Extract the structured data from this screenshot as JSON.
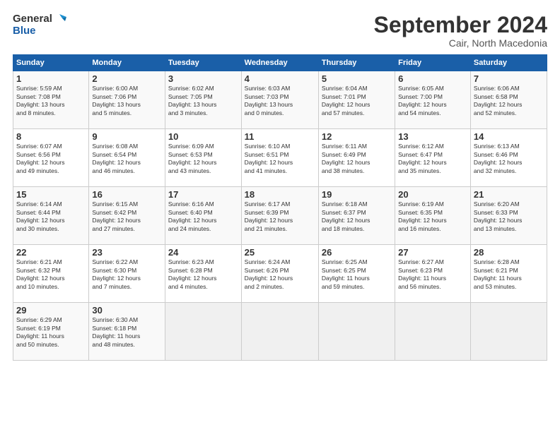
{
  "header": {
    "logo_line1": "General",
    "logo_line2": "Blue",
    "month_title": "September 2024",
    "location": "Cair, North Macedonia"
  },
  "days_of_week": [
    "Sunday",
    "Monday",
    "Tuesday",
    "Wednesday",
    "Thursday",
    "Friday",
    "Saturday"
  ],
  "weeks": [
    [
      {
        "day": "1",
        "lines": [
          "Sunrise: 5:59 AM",
          "Sunset: 7:08 PM",
          "Daylight: 13 hours",
          "and 8 minutes."
        ]
      },
      {
        "day": "2",
        "lines": [
          "Sunrise: 6:00 AM",
          "Sunset: 7:06 PM",
          "Daylight: 13 hours",
          "and 5 minutes."
        ]
      },
      {
        "day": "3",
        "lines": [
          "Sunrise: 6:02 AM",
          "Sunset: 7:05 PM",
          "Daylight: 13 hours",
          "and 3 minutes."
        ]
      },
      {
        "day": "4",
        "lines": [
          "Sunrise: 6:03 AM",
          "Sunset: 7:03 PM",
          "Daylight: 13 hours",
          "and 0 minutes."
        ]
      },
      {
        "day": "5",
        "lines": [
          "Sunrise: 6:04 AM",
          "Sunset: 7:01 PM",
          "Daylight: 12 hours",
          "and 57 minutes."
        ]
      },
      {
        "day": "6",
        "lines": [
          "Sunrise: 6:05 AM",
          "Sunset: 7:00 PM",
          "Daylight: 12 hours",
          "and 54 minutes."
        ]
      },
      {
        "day": "7",
        "lines": [
          "Sunrise: 6:06 AM",
          "Sunset: 6:58 PM",
          "Daylight: 12 hours",
          "and 52 minutes."
        ]
      }
    ],
    [
      {
        "day": "8",
        "lines": [
          "Sunrise: 6:07 AM",
          "Sunset: 6:56 PM",
          "Daylight: 12 hours",
          "and 49 minutes."
        ]
      },
      {
        "day": "9",
        "lines": [
          "Sunrise: 6:08 AM",
          "Sunset: 6:54 PM",
          "Daylight: 12 hours",
          "and 46 minutes."
        ]
      },
      {
        "day": "10",
        "lines": [
          "Sunrise: 6:09 AM",
          "Sunset: 6:53 PM",
          "Daylight: 12 hours",
          "and 43 minutes."
        ]
      },
      {
        "day": "11",
        "lines": [
          "Sunrise: 6:10 AM",
          "Sunset: 6:51 PM",
          "Daylight: 12 hours",
          "and 41 minutes."
        ]
      },
      {
        "day": "12",
        "lines": [
          "Sunrise: 6:11 AM",
          "Sunset: 6:49 PM",
          "Daylight: 12 hours",
          "and 38 minutes."
        ]
      },
      {
        "day": "13",
        "lines": [
          "Sunrise: 6:12 AM",
          "Sunset: 6:47 PM",
          "Daylight: 12 hours",
          "and 35 minutes."
        ]
      },
      {
        "day": "14",
        "lines": [
          "Sunrise: 6:13 AM",
          "Sunset: 6:46 PM",
          "Daylight: 12 hours",
          "and 32 minutes."
        ]
      }
    ],
    [
      {
        "day": "15",
        "lines": [
          "Sunrise: 6:14 AM",
          "Sunset: 6:44 PM",
          "Daylight: 12 hours",
          "and 30 minutes."
        ]
      },
      {
        "day": "16",
        "lines": [
          "Sunrise: 6:15 AM",
          "Sunset: 6:42 PM",
          "Daylight: 12 hours",
          "and 27 minutes."
        ]
      },
      {
        "day": "17",
        "lines": [
          "Sunrise: 6:16 AM",
          "Sunset: 6:40 PM",
          "Daylight: 12 hours",
          "and 24 minutes."
        ]
      },
      {
        "day": "18",
        "lines": [
          "Sunrise: 6:17 AM",
          "Sunset: 6:39 PM",
          "Daylight: 12 hours",
          "and 21 minutes."
        ]
      },
      {
        "day": "19",
        "lines": [
          "Sunrise: 6:18 AM",
          "Sunset: 6:37 PM",
          "Daylight: 12 hours",
          "and 18 minutes."
        ]
      },
      {
        "day": "20",
        "lines": [
          "Sunrise: 6:19 AM",
          "Sunset: 6:35 PM",
          "Daylight: 12 hours",
          "and 16 minutes."
        ]
      },
      {
        "day": "21",
        "lines": [
          "Sunrise: 6:20 AM",
          "Sunset: 6:33 PM",
          "Daylight: 12 hours",
          "and 13 minutes."
        ]
      }
    ],
    [
      {
        "day": "22",
        "lines": [
          "Sunrise: 6:21 AM",
          "Sunset: 6:32 PM",
          "Daylight: 12 hours",
          "and 10 minutes."
        ]
      },
      {
        "day": "23",
        "lines": [
          "Sunrise: 6:22 AM",
          "Sunset: 6:30 PM",
          "Daylight: 12 hours",
          "and 7 minutes."
        ]
      },
      {
        "day": "24",
        "lines": [
          "Sunrise: 6:23 AM",
          "Sunset: 6:28 PM",
          "Daylight: 12 hours",
          "and 4 minutes."
        ]
      },
      {
        "day": "25",
        "lines": [
          "Sunrise: 6:24 AM",
          "Sunset: 6:26 PM",
          "Daylight: 12 hours",
          "and 2 minutes."
        ]
      },
      {
        "day": "26",
        "lines": [
          "Sunrise: 6:25 AM",
          "Sunset: 6:25 PM",
          "Daylight: 11 hours",
          "and 59 minutes."
        ]
      },
      {
        "day": "27",
        "lines": [
          "Sunrise: 6:27 AM",
          "Sunset: 6:23 PM",
          "Daylight: 11 hours",
          "and 56 minutes."
        ]
      },
      {
        "day": "28",
        "lines": [
          "Sunrise: 6:28 AM",
          "Sunset: 6:21 PM",
          "Daylight: 11 hours",
          "and 53 minutes."
        ]
      }
    ],
    [
      {
        "day": "29",
        "lines": [
          "Sunrise: 6:29 AM",
          "Sunset: 6:19 PM",
          "Daylight: 11 hours",
          "and 50 minutes."
        ]
      },
      {
        "day": "30",
        "lines": [
          "Sunrise: 6:30 AM",
          "Sunset: 6:18 PM",
          "Daylight: 11 hours",
          "and 48 minutes."
        ]
      },
      {
        "day": "",
        "lines": []
      },
      {
        "day": "",
        "lines": []
      },
      {
        "day": "",
        "lines": []
      },
      {
        "day": "",
        "lines": []
      },
      {
        "day": "",
        "lines": []
      }
    ]
  ]
}
